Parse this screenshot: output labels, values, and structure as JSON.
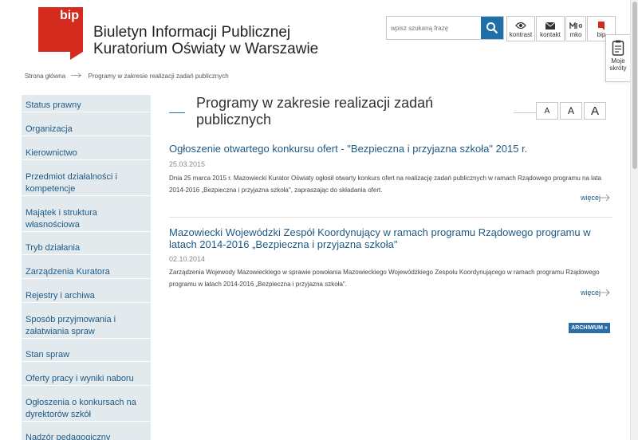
{
  "header": {
    "logo_text": "bip",
    "title_line1": "Biuletyn Informacji Publicznej",
    "title_line2": "Kuratorium Oświaty w Warszawie"
  },
  "search": {
    "placeholder": "wpisz szukaną frazę"
  },
  "tools": [
    {
      "label": "kontrast",
      "icon": "eye-icon"
    },
    {
      "label": "kontakt",
      "icon": "envelope-icon"
    },
    {
      "label": "mko",
      "icon": "mko-icon"
    },
    {
      "label": "bip",
      "icon": "bip-flag-icon"
    }
  ],
  "shortcuts": {
    "line1": "Moje",
    "line2": "skróty",
    "icon": "clipboard-icon"
  },
  "breadcrumb": {
    "home": "Strona główna",
    "current": "Programy w zakresie realizacji zadań publicznych"
  },
  "sidebar": {
    "items": [
      {
        "label": "Status prawny"
      },
      {
        "label": "Organizacja"
      },
      {
        "label": "Kierownictwo"
      },
      {
        "label": "Przedmiot działalności i kompetencje"
      },
      {
        "label": "Majątek i struktura własnościowa"
      },
      {
        "label": "Tryb działania"
      },
      {
        "label": "Zarządzenia Kuratora"
      },
      {
        "label": "Rejestry i archiwa"
      },
      {
        "label": "Sposób przyjmowania i załatwiania spraw"
      },
      {
        "label": "Stan spraw"
      },
      {
        "label": "Oferty pracy i wyniki naboru"
      },
      {
        "label": "Ogłoszenia o konkursach na dyrektorów szkół"
      },
      {
        "label": "Nadzór pedagogiczny"
      }
    ]
  },
  "main": {
    "title": "Programy w zakresie realizacji zadań publicznych",
    "font_sizes": [
      "A",
      "A",
      "A"
    ],
    "articles": [
      {
        "title": "Ogłoszenie otwartego konkursu ofert - \"Bezpieczna i przyjazna szkoła\" 2015 r.",
        "date": "25.03.2015",
        "desc": "Dnia 25 marca 2015 r. Mazowiecki Kurator Oświaty ogłosił otwarty konkurs ofert na realizację zadań publicznych w ramach Rządowego programu na lata 2014-2016 „Bezpieczna i przyjazna szkoła\", zapraszając do składania ofert.",
        "more": "więcej"
      },
      {
        "title": "Mazowiecki Wojewódzki Zespół Koordynujący w ramach programu Rządowego programu w latach 2014-2016 „Bezpieczna i przyjazna szkoła\"",
        "date": "02.10.2014",
        "desc": "Zarządzenia Wojewody Mazowieckiego w sprawie powołania Mazowieckiego Wojewódzkiego Zespołu Koordynującego w ramach programu Rządowego programu w latach 2014-2016 „Bezpieczna i przyjazna szkoła\".",
        "more": "więcej"
      }
    ],
    "archive_label": "ARCHIWUM »"
  },
  "colors": {
    "brand_red": "#d52b1e",
    "link_blue": "#1d5a85",
    "button_blue": "#2b6ea7",
    "sidebar_bg": "#e3eaee"
  }
}
